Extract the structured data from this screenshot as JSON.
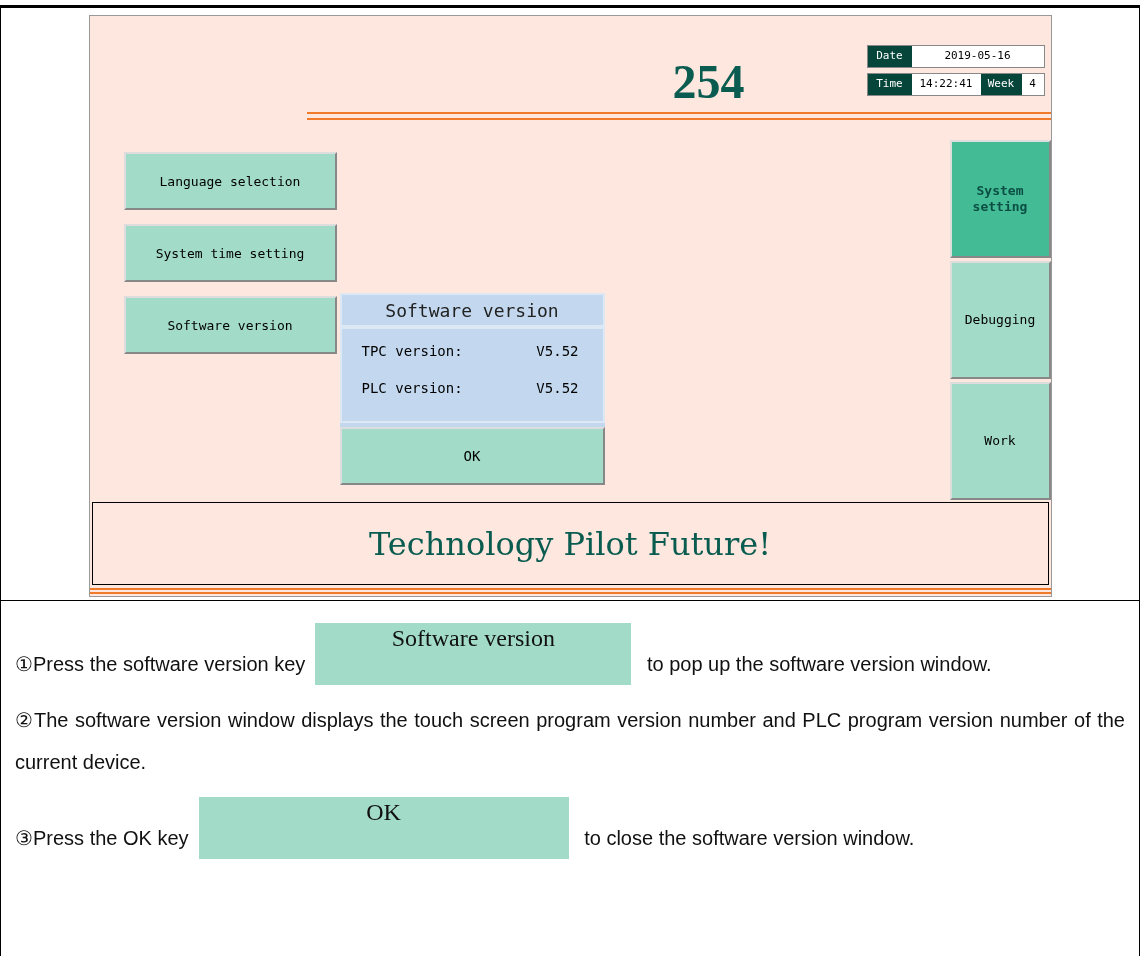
{
  "hmi": {
    "title": "254",
    "clock": {
      "date_label": "Date",
      "date": "2019-05-16",
      "time_label": "Time",
      "time": "14:22:41",
      "week_label": "Week",
      "week": "4"
    },
    "menu_buttons": [
      "Language selection",
      "System time setting",
      "Software version"
    ],
    "nav_tabs": [
      {
        "label": "System setting",
        "selected": true
      },
      {
        "label": "Debugging",
        "selected": false
      },
      {
        "label": "Work",
        "selected": false
      }
    ],
    "dialog": {
      "title": "Software version",
      "rows": [
        {
          "label": "TPC version:",
          "value": "V5.52"
        },
        {
          "label": "PLC version:",
          "value": "V5.52"
        }
      ],
      "button": "OK"
    },
    "banner": "Technology Pilot Future!"
  },
  "steps": [
    {
      "marker": "①",
      "before": "Press the software version key",
      "key": "Software version",
      "after": "to pop up the software version window."
    },
    {
      "marker": "②",
      "before": "The software version window displays the touch screen program version number and PLC program version number of the current device."
    },
    {
      "marker": "③",
      "before": "Press the OK key",
      "key": "OK",
      "after": "to close the software version window."
    }
  ]
}
